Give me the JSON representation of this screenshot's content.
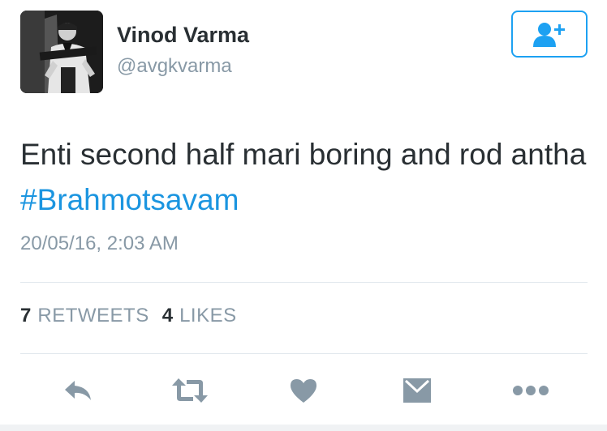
{
  "user": {
    "name": "Vinod Varma",
    "handle": "@avgkvarma",
    "avatar_icon": "profile-photo"
  },
  "follow_button": {
    "icon": "follow-user-icon",
    "color": "#1da1f2"
  },
  "tweet": {
    "text": "Enti second half mari boring and rod antha ",
    "hashtag": "#Brahmotsavam",
    "timestamp": "20/05/16, 2:03 AM"
  },
  "stats": {
    "retweets_count": "7",
    "retweets_label": "RETWEETS",
    "likes_count": "4",
    "likes_label": "LIKES"
  },
  "actions": {
    "reply_icon": "reply-icon",
    "retweet_icon": "retweet-icon",
    "like_icon": "heart-icon",
    "message_icon": "envelope-icon",
    "more_icon": "more-dots-icon"
  },
  "colors": {
    "text": "#292f33",
    "secondary": "#8899a6",
    "link": "#1b95e0",
    "icon": "#8899a6"
  }
}
